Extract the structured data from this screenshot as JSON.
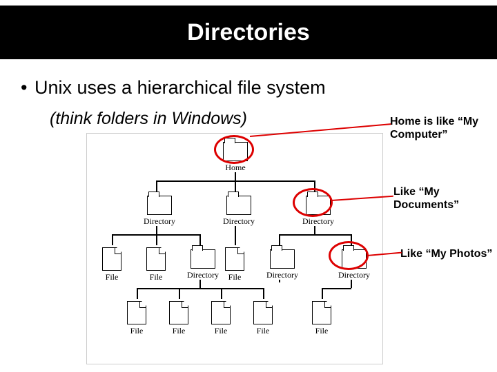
{
  "title": "Directories",
  "bullet": "Unix uses a hierarchical file system",
  "bullet_sub": "(think folders in Windows)",
  "nodes": {
    "home": "Home",
    "dir": "Directory",
    "file": "File"
  },
  "annotations": {
    "a1": "Home is like “My Computer”",
    "a2": "Like “My Documents”",
    "a3": "Like “My Photos”"
  }
}
